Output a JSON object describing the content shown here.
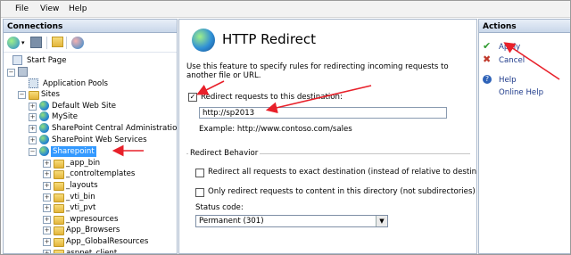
{
  "menu": {
    "file": "File",
    "view": "View",
    "help": "Help"
  },
  "connections": {
    "title": "Connections",
    "tree": [
      {
        "label": "Start Page"
      },
      {
        "label": ""
      },
      {
        "label": "Application Pools"
      },
      {
        "label": "Sites"
      },
      {
        "label": "Default Web Site"
      },
      {
        "label": "MySite"
      },
      {
        "label": "SharePoint Central Administration"
      },
      {
        "label": "SharePoint Web Services"
      },
      {
        "label": "Sharepoint"
      },
      {
        "label": "_app_bin"
      },
      {
        "label": "_controltemplates"
      },
      {
        "label": "_layouts"
      },
      {
        "label": "_vti_bin"
      },
      {
        "label": "_vti_pvt"
      },
      {
        "label": "_wpresources"
      },
      {
        "label": "App_Browsers"
      },
      {
        "label": "App_GlobalResources"
      },
      {
        "label": "aspnet_client"
      }
    ]
  },
  "redirect": {
    "title": "HTTP Redirect",
    "description": "Use this feature to specify rules for redirecting incoming requests to another file or URL.",
    "redirect_label": "Redirect requests to this destination:",
    "destination": "http://sp2013",
    "example": "Example: http://www.contoso.com/sales",
    "behavior_title": "Redirect Behavior",
    "opt_exact": "Redirect all requests to exact destination (instead of relative to destination)",
    "opt_dir": "Only redirect requests to content in this directory (not subdirectories)",
    "status_label": "Status code:",
    "status_value": "Permanent (301)"
  },
  "actions": {
    "title": "Actions",
    "apply": "Apply",
    "cancel": "Cancel",
    "help": "Help",
    "online_help": "Online Help"
  },
  "colors": {
    "accent": "#3399ff",
    "annotation": "#e8202a"
  }
}
